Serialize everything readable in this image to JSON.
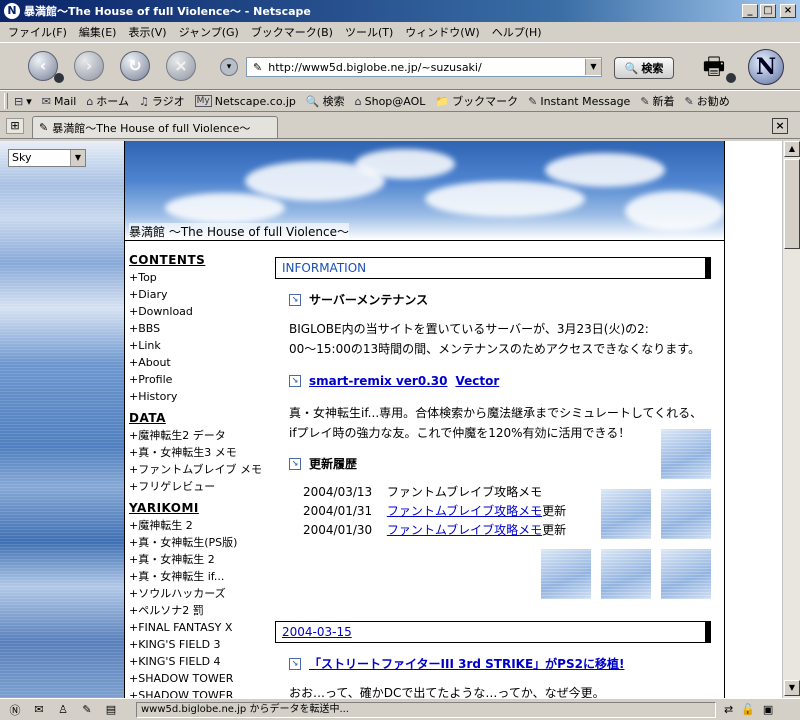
{
  "window": {
    "title": "暴満館〜The House of full Violence〜 - Netscape",
    "app_icon": "N"
  },
  "menu": [
    "ファイル(F)",
    "編集(E)",
    "表示(V)",
    "ジャンプ(G)",
    "ブックマーク(B)",
    "ツール(T)",
    "ウィンドウ(W)",
    "ヘルプ(H)"
  ],
  "nav": {
    "url": "http://www5d.biglobe.ne.jp/~suzusaki/",
    "search_label": "検索"
  },
  "personal_toolbar": [
    {
      "icon": "mail-icon",
      "glyph": "✉",
      "label": "Mail"
    },
    {
      "icon": "home-icon",
      "glyph": "⌂",
      "label": "ホーム"
    },
    {
      "icon": "radio-icon",
      "glyph": "♫",
      "label": "ラジオ"
    },
    {
      "icon": "my-netscape-icon",
      "glyph": "My",
      "label": "Netscape.co.jp"
    },
    {
      "icon": "search-icon",
      "glyph": "🔍",
      "label": "検索"
    },
    {
      "icon": "aol-shop-icon",
      "glyph": "⌂",
      "label": "Shop@AOL"
    },
    {
      "icon": "bookmarks-icon",
      "glyph": "📁",
      "label": "ブックマーク"
    },
    {
      "icon": "instant-message-icon",
      "glyph": "✎",
      "label": "Instant Message"
    },
    {
      "icon": "link-icon",
      "glyph": "✎",
      "label": "新着"
    },
    {
      "icon": "link-icon",
      "glyph": "✎",
      "label": "お勧め"
    }
  ],
  "tab": {
    "title": "暴満館〜The House of full Violence〜"
  },
  "left_frame": {
    "theme_select": "Sky"
  },
  "page": {
    "banner_title": "暴満館 〜The House of full Violence〜",
    "nav_sections": [
      {
        "heading": "CONTENTS",
        "items": [
          "+Top",
          "+Diary",
          "+Download",
          "+BBS",
          "+Link",
          "+About",
          "+Profile",
          "+History"
        ]
      },
      {
        "heading": "DATA",
        "items": [
          "+魔神転生2 データ",
          "+真・女神転生3 メモ",
          "+ファントムブレイブ メモ",
          "+フリゲレビュー"
        ]
      },
      {
        "heading": "YARIKOMI",
        "items": [
          "+魔神転生 2",
          "+真・女神転生(PS版)",
          "+真・女神転生 2",
          "+真・女神転生 if...",
          "+ソウルハッカーズ",
          "+ペルソナ2 罰",
          "+FINAL FANTASY X",
          "+KING'S FIELD 3",
          "+KING'S FIELD 4",
          "+SHADOW TOWER",
          "+SHADOW TOWER"
        ]
      }
    ],
    "information_header": "INFORMATION",
    "maintenance_title": "サーバーメンテナンス",
    "maintenance_text_1": "BIGLOBE内の当サイトを置いているサーバーが、3月23日(火)の2:",
    "maintenance_text_2": "00〜15:00の13時間の間、メンテナンスのためアクセスできなくなります。",
    "remix_link": "smart-remix ver0.30",
    "vector_link": "Vector",
    "remix_text_1": "真・女神転生if...専用。合体検索から魔法継承までシミュレートしてくれる、",
    "remix_text_2": "ifプレイ時の強力な友。これで仲魔を120%有効に活用できる！",
    "history_title": "更新履歴",
    "history": [
      {
        "date": "2004/03/13",
        "text": "ファントムブレイブ攻略メモ",
        "link": "",
        "suffix": ""
      },
      {
        "date": "2004/01/31",
        "text": "",
        "link": "ファントムブレイブ攻略メモ",
        "suffix": "更新"
      },
      {
        "date": "2004/01/30",
        "text": "",
        "link": "ファントムブレイブ攻略メモ",
        "suffix": "更新"
      }
    ],
    "diary_header": "2004-03-15",
    "diary_title": "「ストリートファイターIII 3rd STRIKE」がPS2に移植!",
    "diary_text": "おお…って、確かDCで出てたような…ってか、なぜ今更。"
  },
  "status": {
    "message": "www5d.biglobe.ne.jp からデータを転送中..."
  }
}
